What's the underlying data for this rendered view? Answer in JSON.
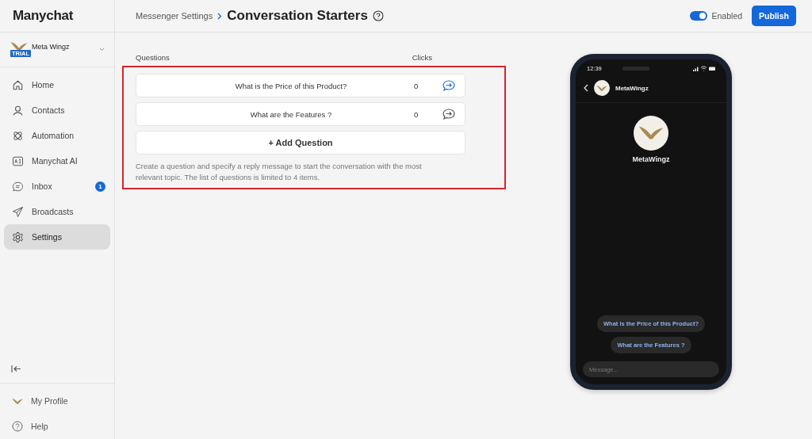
{
  "sidebar": {
    "logo": "Manychat",
    "account": {
      "name": "Meta Wingz",
      "badge": "TRIAL"
    },
    "nav": [
      {
        "label": "Home",
        "selected": false
      },
      {
        "label": "Contacts",
        "selected": false
      },
      {
        "label": "Automation",
        "selected": false
      },
      {
        "label": "Manychat AI",
        "selected": false
      },
      {
        "label": "Inbox",
        "selected": false,
        "badge": "1"
      },
      {
        "label": "Broadcasts",
        "selected": false
      },
      {
        "label": "Settings",
        "selected": true
      }
    ],
    "footer": [
      {
        "label": "My Profile"
      },
      {
        "label": "Help"
      }
    ]
  },
  "header": {
    "breadcrumb": "Messenger Settings",
    "title": "Conversation Starters",
    "toggle": {
      "label": "Enabled",
      "on": true
    },
    "publish": "Publish"
  },
  "starters": {
    "columns": [
      "Questions",
      "Clicks"
    ],
    "questions": [
      {
        "text": "What is the Price of this Product?",
        "clicks": "0",
        "selected": true
      },
      {
        "text": "What are the Features ?",
        "clicks": "0",
        "selected": false
      }
    ],
    "add": "+ Add Question",
    "hint": "Create a question and specify a reply message to start the conversation with the most relevant topic. The list of questions is limited to 4 items."
  },
  "phone": {
    "time": "12:39",
    "contact": "MetaWingz",
    "profile_name": "MetaWingz",
    "quick_replies": [
      "What is the Price of this Product?",
      "What are the Features ?"
    ],
    "placeholder": "Message..."
  }
}
